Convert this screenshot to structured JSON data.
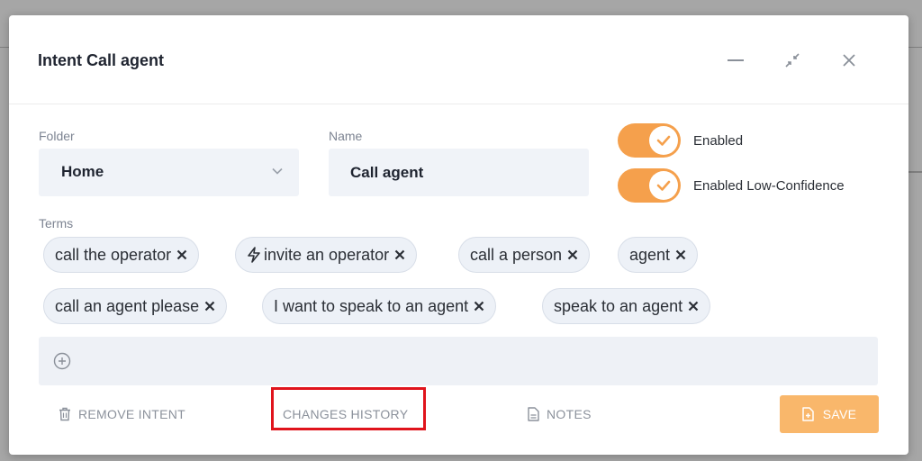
{
  "modal": {
    "title": "Intent Call agent",
    "header_icons": [
      "minimize-icon",
      "collapse-icon",
      "close-icon"
    ]
  },
  "folder": {
    "label": "Folder",
    "value": "Home"
  },
  "name": {
    "label": "Name",
    "value": "Call agent"
  },
  "toggles": [
    {
      "label": "Enabled",
      "on": true
    },
    {
      "label": "Enabled Low-Confidence",
      "on": true
    }
  ],
  "terms": {
    "label": "Terms",
    "items": [
      {
        "text": "call the operator",
        "icon": ""
      },
      {
        "text": "invite an operator",
        "icon": "bolt-icon"
      },
      {
        "text": "call a person",
        "icon": ""
      },
      {
        "text": "agent",
        "icon": ""
      },
      {
        "text": "call an agent please",
        "icon": ""
      },
      {
        "text": "I want to speak to an agent",
        "icon": ""
      },
      {
        "text": "speak to an agent",
        "icon": ""
      }
    ]
  },
  "footer": {
    "remove_label": "REMOVE INTENT",
    "history_label": "CHANGES HISTORY",
    "notes_label": "NOTES",
    "save_label": "SAVE"
  },
  "colors": {
    "accent": "#f5a04c",
    "save": "#f9b76b",
    "highlight": "#e0141c",
    "field_bg": "#f0f3f8"
  }
}
